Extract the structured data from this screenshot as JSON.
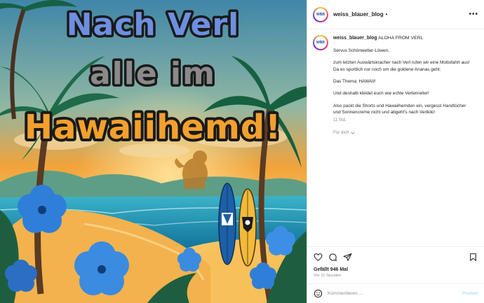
{
  "post": {
    "headline_line1": "Nach Verl",
    "headline_line2": "alle im",
    "headline_line3": "Hawaiihemd!"
  },
  "panel": {
    "username": "weiss_blauer_blog",
    "separator": "•",
    "more_glyph": "•••",
    "avatar_text": "WBB"
  },
  "caption": {
    "username": "weiss_blauer_blog",
    "title": "ALOHA FROM VERL",
    "greeting": "Servus Schönwetter-Löwen,",
    "p1": "zum letzten Auswärtskracher nach Verl rufen wir eine Mottofahrt aus! Da es sportlich nur noch um die goldene Ananas geht:",
    "p2": "Das Thema: HAWAII!",
    "p3": "Und deshalb kleidet euch wie echte Verlenreiter!",
    "p4": "Also packt die Shorts und Hawaiihemden ein, vergesst Handtücher und Sonnencreme nicht und abgeht's nach Verlkiki!",
    "time": "11 Std.",
    "translate": "Für dich"
  },
  "stats": {
    "likes": "Gefällt 946 Mal",
    "ago": "Vor 11 Stunden"
  },
  "comment": {
    "placeholder": "Kommentieren ...",
    "post_label": "Posten"
  },
  "icons": {
    "like": "heart-icon",
    "comment": "comment-icon",
    "share": "share-icon",
    "save": "bookmark-icon",
    "emoji": "smiley-icon"
  },
  "colors": {
    "sky_top": "#3f86a8",
    "sunset": "#f2a33a",
    "sea": "#1c8fb5",
    "headline_blue": "#6d8fe0",
    "headline_orange": "#f3a02d",
    "text_dark": "#262626",
    "muted": "#8e8e8e",
    "post_button": "#b2dffc"
  }
}
